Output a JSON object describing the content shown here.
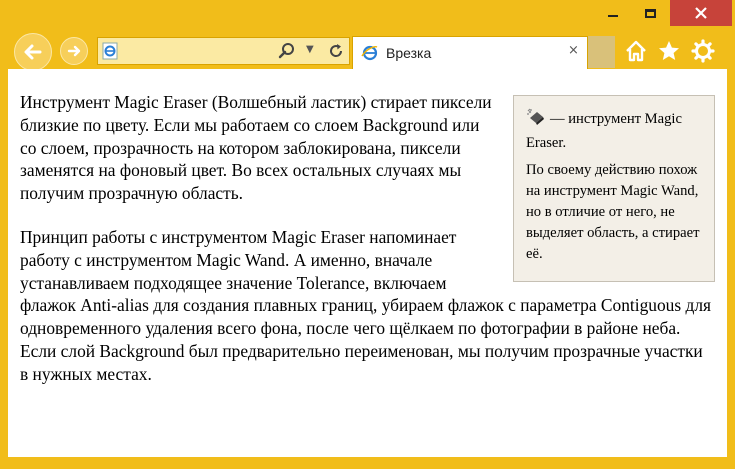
{
  "window": {
    "caption_buttons": [
      "minimize",
      "maximize",
      "close"
    ],
    "accent": "#f1bd1a",
    "close_color": "#c7433a"
  },
  "toolbar": {
    "back_icon": "back-arrow-icon",
    "forward_icon": "forward-arrow-icon",
    "address_value": "",
    "tab_title": "Врезка",
    "tab_close": "×"
  },
  "article": {
    "aside": {
      "line1": "— инструмент Magic Eraser.",
      "line2": "По своему действию похож на инструмент Magic Wand, но в отличие от него, не выделяет область, а стирает её."
    },
    "paragraphs": [
      "Инструмент Magic Eraser (Волшебный ластик) стирает пиксели близкие по цвету. Если мы работаем со слоем Background или со слоем, прозрачность на котором заблокирована, пиксели заменятся на фоновый цвет. Во всех остальных случаях мы получим прозрачную область.",
      "Принцип работы с инструментом Magic Eraser напоминает работу с инструментом Magic Wand. А именно, вначале устанавливаем подходящее значение Tolerance, включаем флажок Anti-alias для создания плавных границ, убираем флажок с параметра Contiguous для одновременного удаления всего фона, после чего щёлкаем по фотографии в районе неба. Если слой Background был предварительно переименован, мы получим прозрачные участки в нужных местах."
    ]
  }
}
